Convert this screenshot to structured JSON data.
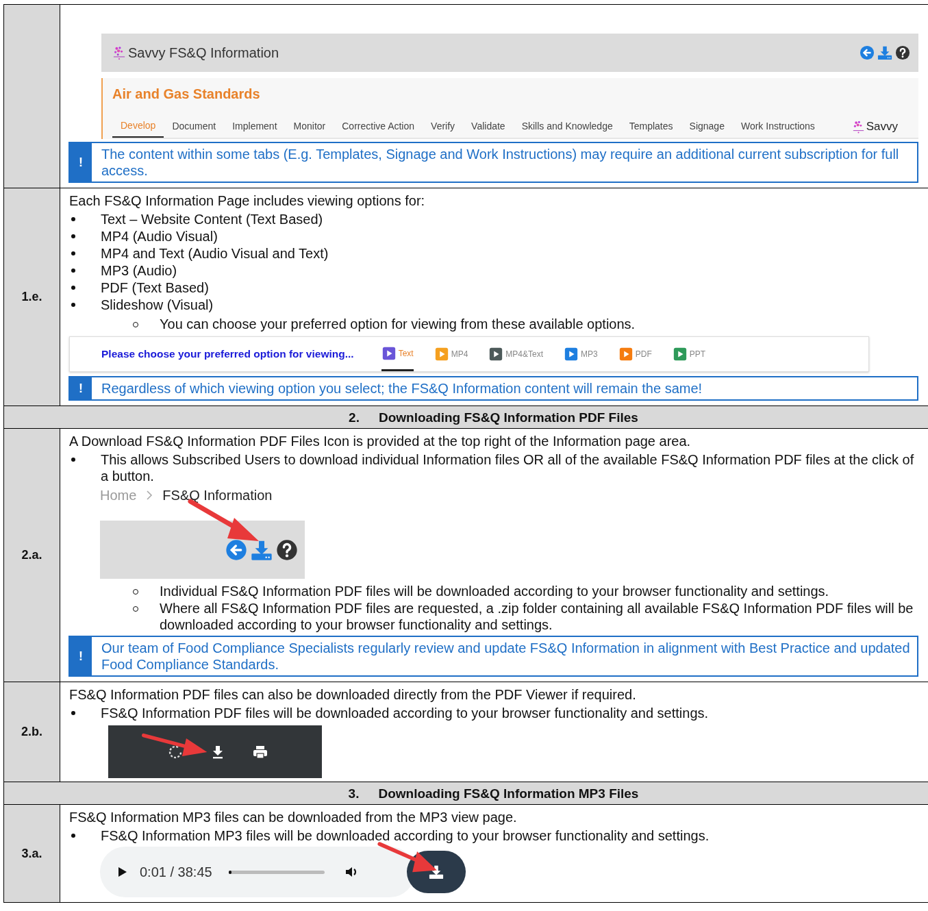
{
  "rows": [
    {
      "kind": "step",
      "blocks": [
        {
          "kind": "app_header",
          "title": "Savvy FS&Q Information",
          "page_title": "Air and Gas Standards",
          "logo_text": "Savvy",
          "tabs": [
            {
              "label": "Develop",
              "selected": true
            },
            {
              "label": "Document",
              "selected": false
            },
            {
              "label": "Implement",
              "selected": false
            },
            {
              "label": "Monitor",
              "selected": false
            },
            {
              "label": "Corrective Action",
              "selected": false
            },
            {
              "label": "Verify",
              "selected": false
            },
            {
              "label": "Validate",
              "selected": false
            },
            {
              "label": "Skills and Knowledge",
              "selected": false
            },
            {
              "label": "Templates",
              "selected": false
            },
            {
              "label": "Signage",
              "selected": false
            },
            {
              "label": "Work Instructions",
              "selected": false
            }
          ]
        },
        {
          "kind": "note",
          "mark": "!",
          "text": "The content within some tabs (E.g. Templates, Signage and Work Instructions) may require an additional current subscription for full access."
        }
      ]
    },
    {
      "kind": "step",
      "label": "1.e.",
      "blocks": [
        {
          "kind": "para",
          "text": "Each FS&Q Information Page includes viewing options for:"
        },
        {
          "kind": "bullets",
          "items": [
            "Text – Website Content (Text Based)",
            "MP4 (Audio Visual)",
            "MP4 and Text (Audio Visual and Text)",
            "MP3 (Audio)",
            "PDF (Text Based)",
            "Slideshow (Visual)"
          ]
        },
        {
          "kind": "subbullets",
          "items": [
            "You can choose your preferred option for viewing from these available options."
          ]
        },
        {
          "kind": "view_options",
          "prompt": "Please choose your preferred option for viewing...",
          "options": [
            {
              "label": "Text",
              "selected": true,
              "color": "#6a55d8"
            },
            {
              "label": "MP4",
              "selected": false,
              "color": "#f5a020"
            },
            {
              "label": "MP4&Text",
              "selected": false,
              "color": "#4d5a5a"
            },
            {
              "label": "MP3",
              "selected": false,
              "color": "#1e7fe0"
            },
            {
              "label": "PDF",
              "selected": false,
              "color": "#f57c10"
            },
            {
              "label": "PPT",
              "selected": false,
              "color": "#2e9a5a"
            }
          ]
        },
        {
          "kind": "note",
          "mark": "!",
          "text": "Regardless of which viewing option you select; the FS&Q Information content will remain the same!"
        }
      ]
    },
    {
      "kind": "heading",
      "number": "2.",
      "text": "Downloading FS&Q Information PDF Files"
    },
    {
      "kind": "step",
      "label": "2.a.",
      "blocks": [
        {
          "kind": "para",
          "text": "A Download FS&Q Information PDF Files Icon is provided at the top right of the Information page area."
        },
        {
          "kind": "bullets",
          "items": [
            "This allows Subscribed Users to download individual Information files OR all of the available FS&Q Information PDF files at the click of a button."
          ]
        },
        {
          "kind": "breadcrumb_shot",
          "crumbs": [
            "Home",
            "FS&Q Information"
          ]
        },
        {
          "kind": "subbullets",
          "items": [
            "Individual FS&Q Information PDF files will be downloaded according to your browser functionality and settings.",
            "Where all FS&Q Information PDF files are requested, a .zip folder containing all available FS&Q Information PDF files will be downloaded according to your browser functionality and settings."
          ]
        },
        {
          "kind": "note",
          "mark": "!",
          "text": "Our team of Food Compliance Specialists regularly review and update FS&Q Information in alignment with Best Practice and updated Food Compliance Standards."
        }
      ]
    },
    {
      "kind": "step",
      "label": "2.b.",
      "blocks": [
        {
          "kind": "para",
          "text": "FS&Q Information PDF files can also be downloaded directly from the PDF Viewer if required."
        },
        {
          "kind": "bullets",
          "items": [
            "FS&Q Information PDF files will be downloaded according to your browser functionality and settings."
          ]
        },
        {
          "kind": "pdf_toolbar"
        }
      ]
    },
    {
      "kind": "heading",
      "number": "3.",
      "text": "Downloading FS&Q Information MP3 Files"
    },
    {
      "kind": "step",
      "label": "3.a.",
      "blocks": [
        {
          "kind": "para",
          "text": "FS&Q Information MP3 files can be downloaded from the MP3 view page."
        },
        {
          "kind": "bullets",
          "items": [
            "FS&Q Information MP3 files will be downloaded according to your browser functionality and settings."
          ]
        },
        {
          "kind": "audio_player",
          "time": "0:01 / 38:45",
          "level": 0.02
        }
      ]
    }
  ]
}
